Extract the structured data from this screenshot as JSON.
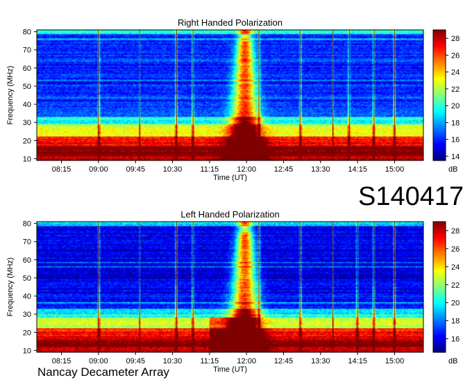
{
  "event_id": "S140417",
  "footer_text": "Nancay Decameter Array",
  "colormap": [
    "#00007f",
    "#0000ff",
    "#007fff",
    "#00ffff",
    "#7fff7f",
    "#ffff00",
    "#ff7f00",
    "#ff0000",
    "#7f0000"
  ],
  "chart_data": [
    {
      "type": "heatmap",
      "title": "Right Handed Polarization",
      "xlabel": "Time (UT)",
      "ylabel": "Frequency (MHz)",
      "x_ticks": [
        "08:15",
        "09:00",
        "09:45",
        "10:30",
        "11:15",
        "12:00",
        "12:45",
        "13:30",
        "14:15",
        "15:00"
      ],
      "y_ticks": [
        10,
        20,
        30,
        40,
        50,
        60,
        70,
        80
      ],
      "ylim": [
        9,
        81
      ],
      "colorbar": {
        "label": "dB",
        "range": [
          13.5,
          29.0
        ],
        "ticks": [
          14,
          16,
          18,
          20,
          22,
          24,
          26,
          28
        ]
      },
      "features": {
        "burst_center_time": "11:58",
        "burst_peak_mhz": 80,
        "vertical_streaks": [
          "09:00",
          "09:50",
          "10:35",
          "10:55",
          "12:15",
          "13:05",
          "13:45",
          "14:05",
          "14:35",
          "15:00"
        ],
        "strong_band_mhz": [
          10,
          22
        ]
      }
    },
    {
      "type": "heatmap",
      "title": "Left Handed Polarization",
      "xlabel": "Time (UT)",
      "ylabel": "Frequency (MHz)",
      "x_ticks": [
        "08:15",
        "09:00",
        "09:45",
        "10:30",
        "11:15",
        "12:00",
        "12:45",
        "13:30",
        "14:15",
        "15:00"
      ],
      "y_ticks": [
        10,
        20,
        30,
        40,
        50,
        60,
        70,
        80
      ],
      "ylim": [
        9,
        81
      ],
      "colorbar": {
        "label": "dB",
        "range": [
          14.5,
          29.0
        ],
        "ticks": [
          16,
          18,
          20,
          22,
          24,
          26,
          28
        ]
      },
      "features": {
        "burst_center_time": "11:58",
        "burst_peak_mhz": 80,
        "vertical_streaks": [
          "09:00",
          "09:50",
          "10:35",
          "10:55",
          "12:15",
          "13:05",
          "13:45",
          "14:15",
          "14:35",
          "15:00"
        ],
        "strong_band_mhz": [
          10,
          22
        ]
      }
    }
  ]
}
